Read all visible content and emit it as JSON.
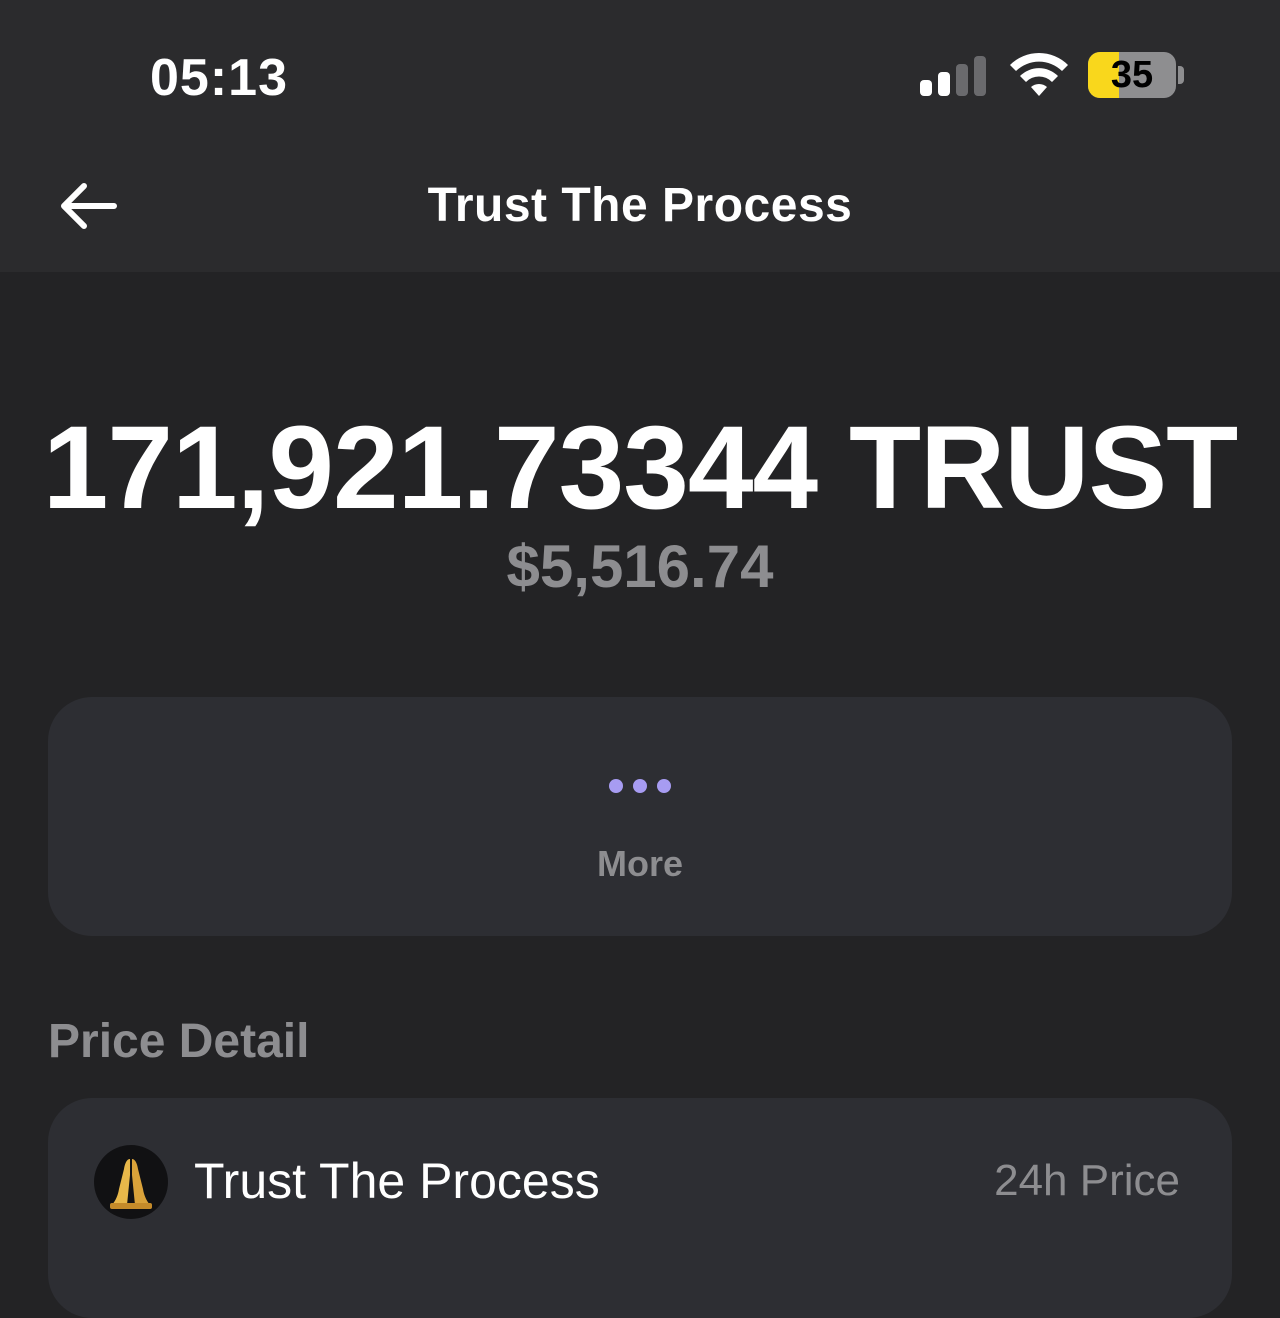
{
  "status_bar": {
    "time": "05:13",
    "battery_level": "35",
    "battery_fraction": 0.35,
    "signal_bars_active": 2,
    "signal_bars_total": 4,
    "battery_color": "#f9d71c"
  },
  "nav": {
    "back_icon": "arrow-left-icon",
    "title": "Trust The Process"
  },
  "balance": {
    "amount": "171,921.73344 TRUST",
    "fiat_value": "$5,516.74"
  },
  "actions": {
    "more_icon": "more-dots-icon",
    "more_label": "More",
    "accent_color": "#a79cf2"
  },
  "price_detail": {
    "section_title": "Price Detail",
    "token_icon": "folded-hands-icon",
    "token_name": "Trust The Process",
    "price_label": "24h Price"
  }
}
